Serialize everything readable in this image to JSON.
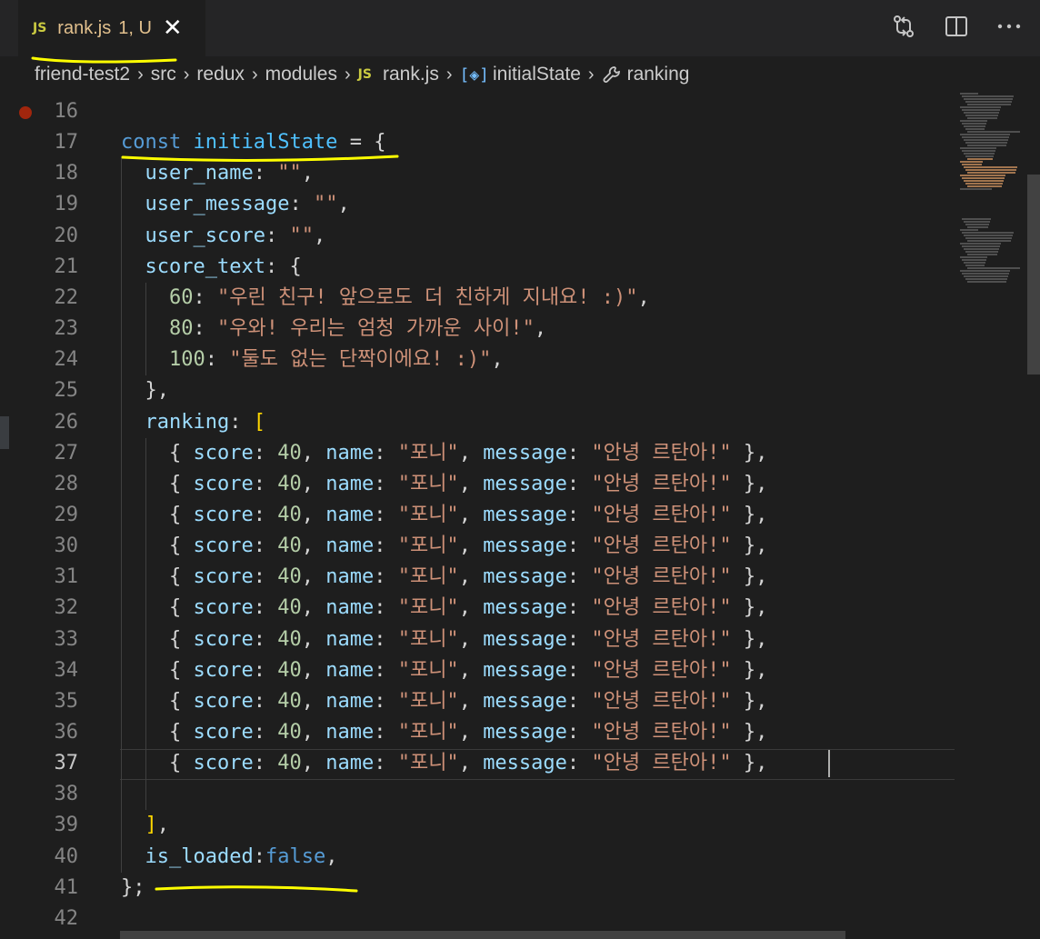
{
  "tab": {
    "icon": "JS",
    "label": "rank.js",
    "status": "1, U",
    "close": "✕"
  },
  "breadcrumb": {
    "items": [
      "friend-test2",
      "src",
      "redux",
      "modules",
      "rank.js",
      "initialState",
      "ranking"
    ],
    "file_icon": "JS",
    "var_icon": "[◈]"
  },
  "icons": {
    "compare": "git-compare-icon",
    "split": "split-editor-icon",
    "more": "more-actions-icon",
    "wrench": "wrench-icon"
  },
  "code": {
    "lines": [
      {
        "n": "16",
        "text": ""
      },
      {
        "n": "17",
        "text": "const initialState = {"
      },
      {
        "n": "18",
        "text": "  user_name: \"\","
      },
      {
        "n": "19",
        "text": "  user_message: \"\","
      },
      {
        "n": "20",
        "text": "  user_score: \"\","
      },
      {
        "n": "21",
        "text": "  score_text: {"
      },
      {
        "n": "22",
        "text": "    60: \"우린 친구! 앞으로도 더 친하게 지내요! :)\","
      },
      {
        "n": "23",
        "text": "    80: \"우와! 우리는 엄청 가까운 사이!\","
      },
      {
        "n": "24",
        "text": "    100: \"둘도 없는 단짝이에요! :)\","
      },
      {
        "n": "25",
        "text": "  },"
      },
      {
        "n": "26",
        "text": "  ranking: ["
      },
      {
        "n": "27",
        "text": "    { score: 40, name: \"포니\", message: \"안녕 르탄아!\" },"
      },
      {
        "n": "28",
        "text": "    { score: 40, name: \"포니\", message: \"안녕 르탄아!\" },"
      },
      {
        "n": "29",
        "text": "    { score: 40, name: \"포니\", message: \"안녕 르탄아!\" },"
      },
      {
        "n": "30",
        "text": "    { score: 40, name: \"포니\", message: \"안녕 르탄아!\" },"
      },
      {
        "n": "31",
        "text": "    { score: 40, name: \"포니\", message: \"안녕 르탄아!\" },"
      },
      {
        "n": "32",
        "text": "    { score: 40, name: \"포니\", message: \"안녕 르탄아!\" },"
      },
      {
        "n": "33",
        "text": "    { score: 40, name: \"포니\", message: \"안녕 르탄아!\" },"
      },
      {
        "n": "34",
        "text": "    { score: 40, name: \"포니\", message: \"안녕 르탄아!\" },"
      },
      {
        "n": "35",
        "text": "    { score: 40, name: \"포니\", message: \"안녕 르탄아!\" },"
      },
      {
        "n": "36",
        "text": "    { score: 40, name: \"포니\", message: \"안녕 르탄아!\" },"
      },
      {
        "n": "37",
        "text": "    { score: 40, name: \"포니\", message: \"안녕 르탄아!\" },"
      },
      {
        "n": "38",
        "text": ""
      },
      {
        "n": "39",
        "text": "  ],"
      },
      {
        "n": "40",
        "text": "  is_loaded:false,"
      },
      {
        "n": "41",
        "text": "};"
      },
      {
        "n": "42",
        "text": ""
      }
    ],
    "current_line": "37"
  },
  "colors": {
    "keyword": "#569cd6",
    "constant": "#4fc1ff",
    "property": "#9cdcfe",
    "string": "#ce9178",
    "number": "#b5cea8",
    "bracket": "#ffd700",
    "annotation": "#ffff00"
  }
}
